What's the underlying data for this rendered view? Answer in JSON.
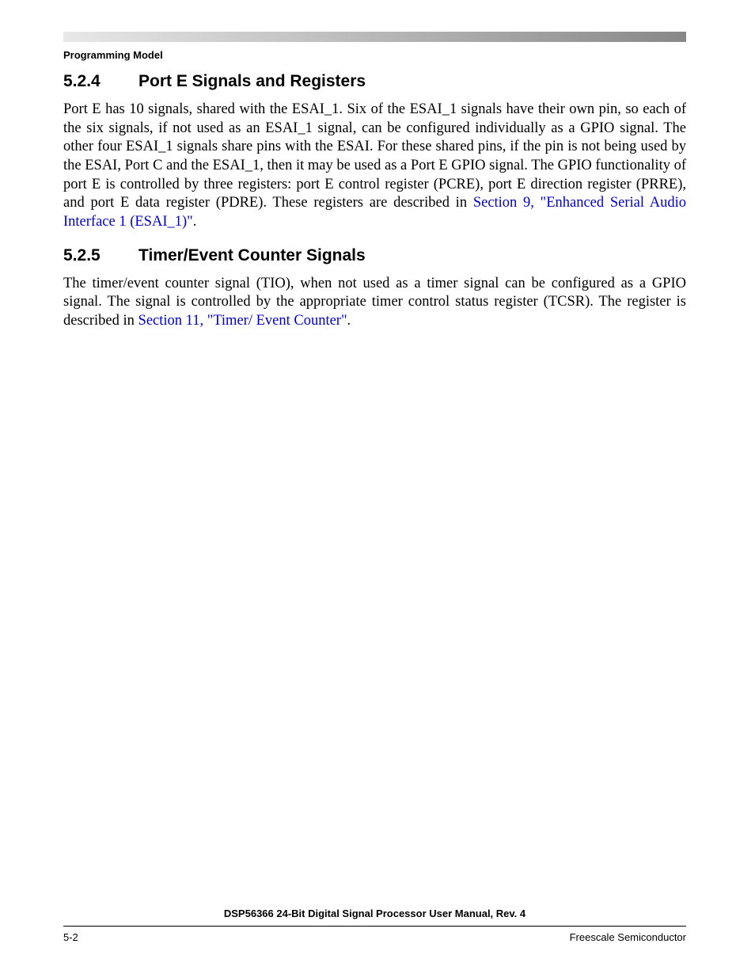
{
  "runningHeader": "Programming Model",
  "sections": [
    {
      "number": "5.2.4",
      "title": "Port E Signals and Registers",
      "bodyPre": "Port E has 10 signals, shared with the ESAI_1. Six of the ESAI_1 signals have their own pin, so each of the six signals, if not used as an ESAI_1 signal, can be configured individually as a GPIO signal. The other four ESAI_1 signals share pins with the ESAI. For these shared pins, if the pin is not being used by the ESAI, Port C and the ESAI_1, then it may be used as a Port E GPIO signal. The GPIO functionality of port E is controlled by three registers: port E control register (PCRE), port E direction register (PRRE), and port E data register (PDRE). These registers are described in ",
      "link": "Section 9, \"Enhanced Serial Audio Interface 1 (ESAI_1)\"",
      "bodyPost": "."
    },
    {
      "number": "5.2.5",
      "title": "Timer/Event Counter Signals",
      "bodyPre": "The timer/event counter signal (TIO), when not used as a timer signal can be configured as a GPIO signal. The signal is controlled by the appropriate timer control status register (TCSR). The register is described in ",
      "link": "Section 11, \"Timer/ Event Counter\"",
      "bodyPost": "."
    }
  ],
  "footer": {
    "docTitle": "DSP56366 24-Bit Digital Signal Processor User Manual, Rev. 4",
    "pageNumber": "5-2",
    "company": "Freescale Semiconductor"
  }
}
